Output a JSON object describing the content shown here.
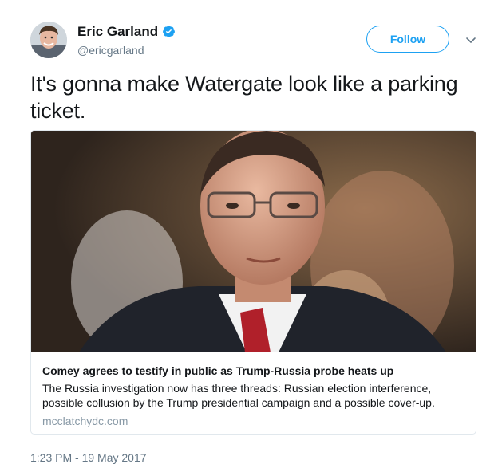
{
  "author": {
    "name": "Eric Garland",
    "handle": "@ericgarland",
    "verified": true,
    "avatar_icon": "profile-photo"
  },
  "actions": {
    "follow_label": "Follow",
    "menu_icon": "chevron-down-icon"
  },
  "tweet": {
    "text": "It's gonna make Watergate look like a parking ticket.",
    "timestamp": "1:23 PM - 19 May 2017"
  },
  "card": {
    "title": "Comey agrees to testify in public as Trump-Russia probe heats up",
    "description": "The Russia investigation now has three threads: Russian election interference, possible collusion by the Trump presidential campaign and a possible cover-up.",
    "domain": "mcclatchydc.com",
    "image_icon": "news-photo"
  },
  "colors": {
    "accent": "#1da1f2",
    "text": "#14171a",
    "secondary_text": "#657786",
    "domain_text": "#8899a6",
    "border": "#e1e8ed"
  }
}
